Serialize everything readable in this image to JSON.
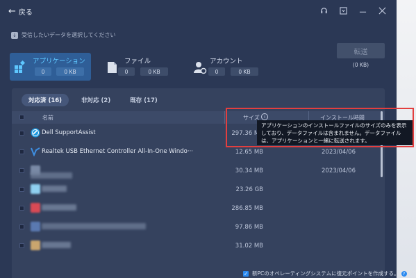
{
  "titlebar": {
    "back_label": "戻る",
    "icons": [
      "headset-icon",
      "download-box-icon",
      "minimize-icon",
      "close-icon"
    ]
  },
  "hint": "受信したいデータを選択してください",
  "categories": [
    {
      "title": "アプリケーション",
      "count": "0",
      "size": "0 KB",
      "icon": "apps-icon"
    },
    {
      "title": "ファイル",
      "count": "0",
      "size": "0 KB",
      "icon": "file-icon"
    },
    {
      "title": "アカウント",
      "count": "0",
      "size": "0 KB",
      "icon": "account-gear-icon"
    }
  ],
  "send": {
    "label": "転送",
    "size": "(0 KB)"
  },
  "tabs": [
    {
      "label": "対応済 (16)"
    },
    {
      "label": "非対応 (2)"
    },
    {
      "label": "既存 (17)"
    }
  ],
  "columns": {
    "name": "名前",
    "size": "サイズ",
    "date": "インストール時間"
  },
  "rows": [
    {
      "name": "Dell SupportAssist",
      "size": "297.36 MB",
      "date": "",
      "icon": "dell-supportassist-icon"
    },
    {
      "name": "Realtek USB Ethernet Controller All-In-One Windo···",
      "size": "12.65 MB",
      "date": "2023/04/06",
      "icon": "realtek-icon"
    },
    {
      "name": "",
      "size": "30.34 MB",
      "date": "2023/04/06",
      "icon": "blurred-app-icon"
    },
    {
      "name": "",
      "size": "23.26 GB",
      "date": "",
      "icon": "blurred-app-icon"
    },
    {
      "name": "",
      "size": "286.85 MB",
      "date": "",
      "icon": "blurred-app-icon"
    },
    {
      "name": "",
      "size": "97.86 MB",
      "date": "",
      "icon": "blurred-app-icon"
    },
    {
      "name": "",
      "size": "31.02 MB",
      "date": "",
      "icon": "blurred-app-icon"
    }
  ],
  "tooltip": "アプリケーションのインストールファイルのサイズのみを表示しており、データファイルは含まれません。データファイルは、アプリケーションと一緒に転送されます。",
  "footer": "新PCのオペレーティングシステムに復元ポイントを作成する。",
  "colors": {
    "accent": "#5ec7ff",
    "active_bg": "#2f5e97",
    "highlight_border": "#e33f3f",
    "checkbox_blue": "#2b8af0"
  }
}
